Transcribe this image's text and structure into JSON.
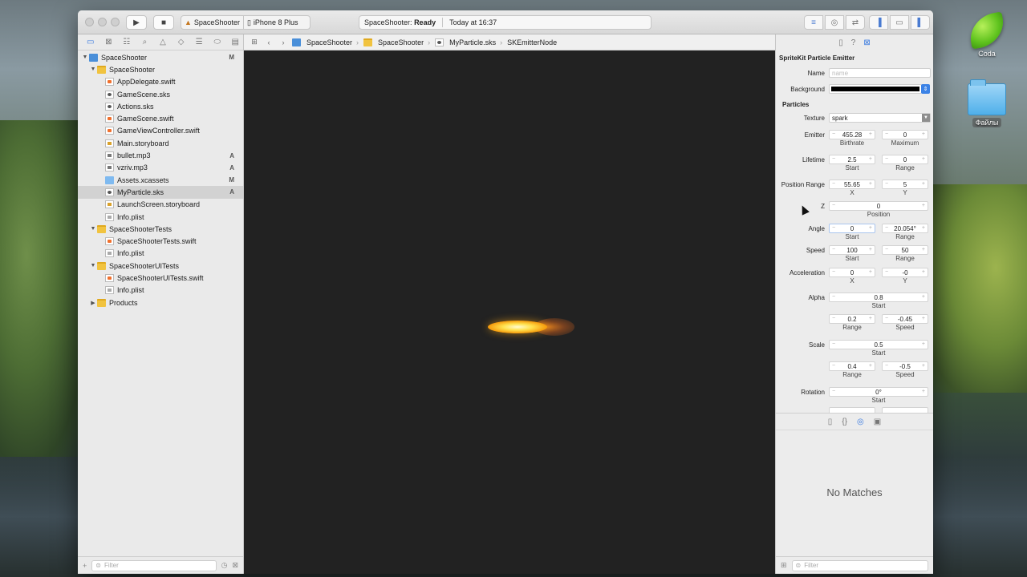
{
  "desktop": {
    "icons": [
      {
        "label": "Coda"
      },
      {
        "label": "Файлы"
      }
    ]
  },
  "toolbar": {
    "scheme_target": "SpaceShooter",
    "scheme_device": "iPhone 8 Plus",
    "status_project": "SpaceShooter:",
    "status_state": "Ready",
    "status_time": "Today at 16:37"
  },
  "navigator": {
    "filter_placeholder": "Filter",
    "items": [
      {
        "label": "SpaceShooter",
        "badge": "M"
      },
      {
        "label": "SpaceShooter",
        "badge": ""
      },
      {
        "label": "AppDelegate.swift",
        "badge": ""
      },
      {
        "label": "GameScene.sks",
        "badge": ""
      },
      {
        "label": "Actions.sks",
        "badge": ""
      },
      {
        "label": "GameScene.swift",
        "badge": ""
      },
      {
        "label": "GameViewController.swift",
        "badge": ""
      },
      {
        "label": "Main.storyboard",
        "badge": ""
      },
      {
        "label": "bullet.mp3",
        "badge": "A"
      },
      {
        "label": "vzriv.mp3",
        "badge": "A"
      },
      {
        "label": "Assets.xcassets",
        "badge": "M"
      },
      {
        "label": "MyParticle.sks",
        "badge": "A"
      },
      {
        "label": "LaunchScreen.storyboard",
        "badge": ""
      },
      {
        "label": "Info.plist",
        "badge": ""
      },
      {
        "label": "SpaceShooterTests",
        "badge": ""
      },
      {
        "label": "SpaceShooterTests.swift",
        "badge": ""
      },
      {
        "label": "Info.plist",
        "badge": ""
      },
      {
        "label": "SpaceShooterUITests",
        "badge": ""
      },
      {
        "label": "SpaceShooterUITests.swift",
        "badge": ""
      },
      {
        "label": "Info.plist",
        "badge": ""
      },
      {
        "label": "Products",
        "badge": ""
      }
    ]
  },
  "jumpbar": {
    "crumbs": [
      "SpaceShooter",
      "SpaceShooter",
      "MyParticle.sks",
      "SKEmitterNode"
    ]
  },
  "inspector": {
    "title": "SpriteKit Particle Emitter",
    "name_label": "Name",
    "name_placeholder": "name",
    "background_label": "Background",
    "background_color": "#000000",
    "particles_section": "Particles",
    "texture_label": "Texture",
    "texture_value": "spark",
    "emitter_label": "Emitter",
    "emitter_birthrate": "455.28",
    "emitter_maximum": "0",
    "birthrate_label": "Birthrate",
    "maximum_label": "Maximum",
    "lifetime_label": "Lifetime",
    "lifetime_start": "2.5",
    "lifetime_range": "0",
    "start_label": "Start",
    "range_label": "Range",
    "position_range_label": "Position Range",
    "position_range_x": "55.65",
    "position_range_y": "5",
    "x_label": "X",
    "y_label": "Y",
    "z_label": "Z",
    "z_position": "0",
    "position_label": "Position",
    "angle_label": "Angle",
    "angle_start": "0",
    "angle_range": "20.054°",
    "speed_label": "Speed",
    "speed_start": "100",
    "speed_range": "50",
    "acceleration_label": "Acceleration",
    "acceleration_x": "0",
    "acceleration_y": "-0",
    "alpha_label": "Alpha",
    "alpha_start": "0.8",
    "alpha_range": "0.2",
    "alpha_speed": "-0.45",
    "speed_sublabel": "Speed",
    "scale_label": "Scale",
    "scale_start": "0.5",
    "scale_range": "0.4",
    "scale_speed": "-0.5",
    "rotation_label": "Rotation",
    "rotation_start": "0°",
    "no_matches": "No Matches",
    "filter_placeholder": "Filter"
  },
  "colors": {
    "accent": "#3b7be0",
    "canvas": "#222222",
    "particle_core": "#ffe14d",
    "particle_tail": "#f59a0b"
  }
}
